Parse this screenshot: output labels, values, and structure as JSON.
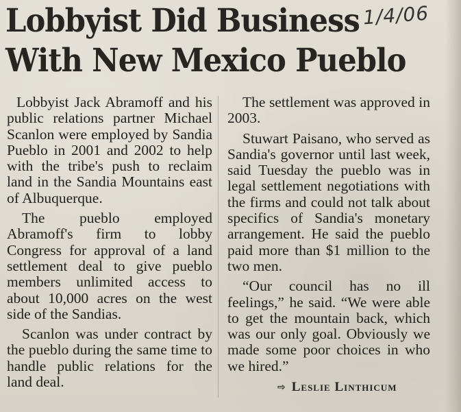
{
  "article": {
    "headline_line1": "Lobbyist Did Business",
    "headline_line2": "With New Mexico Pueblo",
    "handwritten_date": "1/4/06",
    "left_paragraphs": [
      "Lobbyist Jack Abramoff and his public relations partner Michael Scanlon were employed by Sandia Pueblo in 2001 and 2002 to help with the tribe's push to reclaim land in the Sandia Mountains east of Albuquerque.",
      "The pueblo employed Abramoff's firm to lobby Congress for approval of a land settlement deal to give pueblo members unlimited access to about 10,000 acres on the west side of the Sandias.",
      "Scanlon was under contract by the pueblo during the same time to handle public relations for the land deal."
    ],
    "right_paragraphs": [
      "The settlement was approved in 2003.",
      "Stuwart Paisano, who served as Sandia's governor until last week, said Tuesday the pueblo was in legal settlement negotiations with the firms and could not talk about specifics of Sandia's monetary arrangement. He said the pueblo paid more than $1 million to the two men.",
      "“Our council has no ill feelings,” he said. “We were able to get the mountain back, which was our only goal. Obviously we made some poor choices in who we hired.”"
    ],
    "byline_arrow": "⇨",
    "byline_name": "Leslie Linthicum"
  }
}
